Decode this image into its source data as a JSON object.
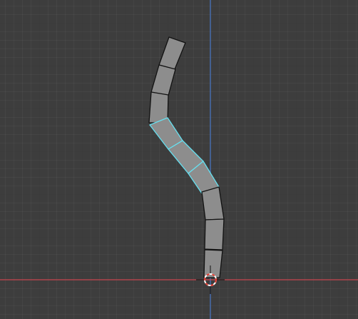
{
  "viewport": {
    "grid_background": "#3d3d3d",
    "x_axis_color": "#c8454f",
    "y_axis_color": "#4a78c9",
    "bone_fill": "#8d8d8d",
    "bone_outline": "#121212",
    "selection_color": "#66e0f0",
    "cursor_colors": [
      "#ffffff",
      "#e03a2f"
    ]
  },
  "armature": {
    "bone_count": 8,
    "selected_bones": [
      4,
      5,
      6
    ]
  }
}
